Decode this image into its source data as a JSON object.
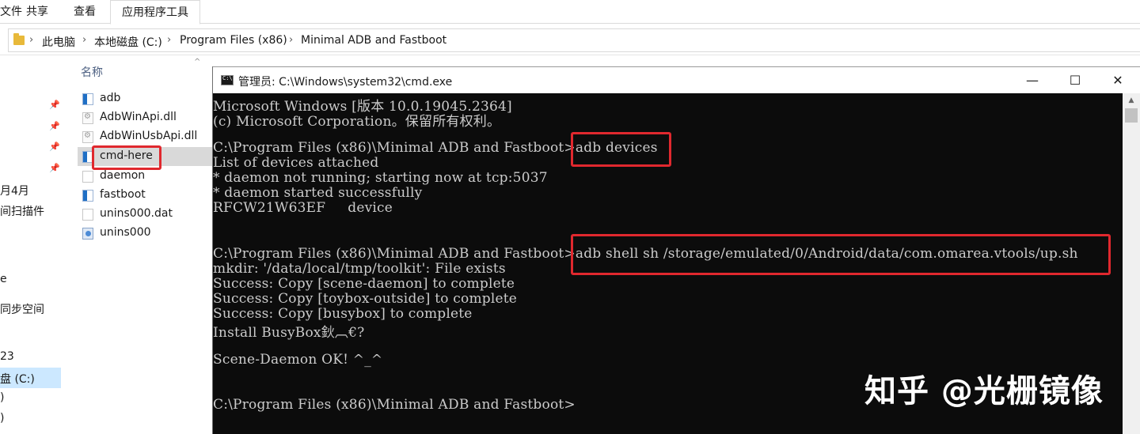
{
  "ribbon": {
    "tabs": [
      {
        "label": "文件"
      },
      {
        "label": "共享"
      },
      {
        "label": "查看"
      },
      {
        "label": "应用程序工具"
      }
    ]
  },
  "address": {
    "crumbs": [
      "此电脑",
      "本地磁盘 (C:)",
      "Program Files (x86)",
      "Minimal ADB and Fastboot"
    ]
  },
  "nav": {
    "items": [
      "月4月",
      "间扫描件",
      "e",
      "同步空间",
      "23",
      "盘 (C:)",
      ")",
      ")"
    ]
  },
  "file_list": {
    "header": "名称",
    "files": [
      {
        "name": "adb",
        "icon": "exe-icon"
      },
      {
        "name": "AdbWinApi.dll",
        "icon": "dll-icon"
      },
      {
        "name": "AdbWinUsbApi.dll",
        "icon": "dll-icon"
      },
      {
        "name": "cmd-here",
        "icon": "exe-icon"
      },
      {
        "name": "daemon",
        "icon": "file-icon"
      },
      {
        "name": "fastboot",
        "icon": "exe-icon"
      },
      {
        "name": "unins000.dat",
        "icon": "file-icon"
      },
      {
        "name": "unins000",
        "icon": "setup-icon"
      }
    ]
  },
  "cmd": {
    "title": "管理员: C:\\Windows\\system32\\cmd.exe",
    "lines": [
      "Microsoft Windows [版本 10.0.19045.2364]",
      "(c) Microsoft Corporation。保留所有权利。",
      "",
      "C:\\Program Files (x86)\\Minimal ADB and Fastboot>adb devices",
      "List of devices attached",
      "* daemon not running; starting now at tcp:5037",
      "* daemon started successfully",
      "RFCW21W63EF     device",
      "",
      "",
      "C:\\Program Files (x86)\\Minimal ADB and Fastboot>adb shell sh /storage/emulated/0/Android/data/com.omarea.vtools/up.sh",
      "mkdir: '/data/local/tmp/toolkit': File exists",
      "Success: Copy [scene-daemon] to complete",
      "Success: Copy [toybox-outside] to complete",
      "Success: Copy [busybox] to complete",
      "Install BusyBox鈥︹€?",
      "",
      "Scene-Daemon OK! ^_^",
      "",
      "",
      "C:\\Program Files (x86)\\Minimal ADB and Fastboot>"
    ]
  },
  "watermark": "知乎 @光栅镜像",
  "colors": {
    "highlight": "#e0282e",
    "console_bg": "#0c0c0c",
    "console_text": "#cccccc"
  }
}
